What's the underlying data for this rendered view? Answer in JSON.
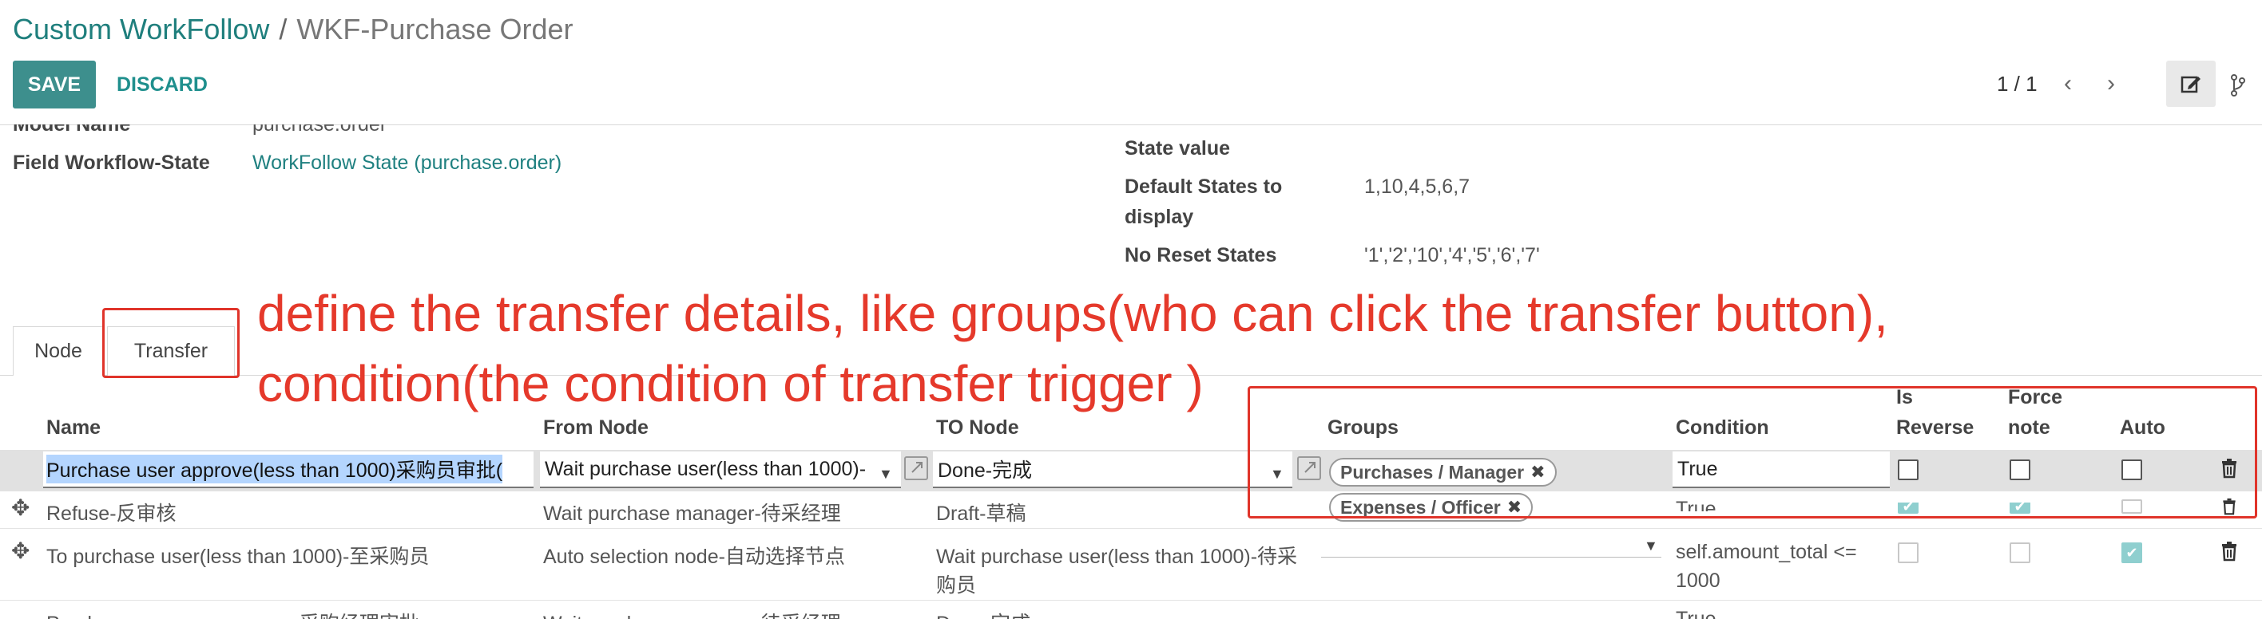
{
  "breadcrumb": {
    "parent": "Custom WorkFollow",
    "separator": "/",
    "current": "WKF-Purchase Order"
  },
  "toolbar": {
    "save": "SAVE",
    "discard": "DISCARD"
  },
  "pager": {
    "value": "1 / 1",
    "prev": "‹",
    "next": "›"
  },
  "form": {
    "model_name_label": "Model Name",
    "model_name_value": "purchase.order",
    "field_state_label": "Field Workflow-State",
    "field_state_value": "WorkFollow State (purchase.order)",
    "state_value_label": "State value",
    "default_states_label_1": "Default States to",
    "default_states_label_2": "display",
    "default_states_value": "1,10,4,5,6,7",
    "no_reset_label": "No Reset States",
    "no_reset_value": "'1','2','10','4','5','6','7'"
  },
  "tabs": [
    "Node",
    "Transfer"
  ],
  "annotation": {
    "line1": "define the transfer details, like groups(who can click the transfer button),",
    "line2": "condition(the condition of transfer trigger )"
  },
  "table": {
    "headers": {
      "name": "Name",
      "from": "From Node",
      "to": "TO Node",
      "groups": "Groups",
      "condition": "Condition",
      "is_reverse_1": "Is",
      "is_reverse_2": "Reverse",
      "force_note_1": "Force",
      "force_note_2": "note",
      "auto": "Auto"
    },
    "edit_row": {
      "name": "Purchase user approve(less than 1000)采购员审批(",
      "from": "Wait purchase user(less than 1000)-",
      "to": "Done-完成",
      "groups": [
        "Purchases / Manager",
        "Expenses / Officer"
      ],
      "condition": "True"
    },
    "rows": [
      {
        "name": "Refuse-反审核",
        "from": "Wait purchase manager-待采经理",
        "to": "Draft-草稿",
        "condition": "True"
      },
      {
        "name": "To purchase user(less than 1000)-至采购员",
        "from": "Auto selection node-自动选择节点",
        "to_1": "Wait purchase user(less than 1000)-待采",
        "to_2": "购员",
        "condition_1": "self.amount_total <=",
        "condition_2": "1000"
      },
      {
        "name": "Purchase manager approve-采购经理审批",
        "from": "Wait purchase manager-待采经理",
        "to": "Done-完成",
        "condition": "True"
      }
    ]
  },
  "colors": {
    "accent": "#00A09D",
    "annotation": "#e5392b",
    "selected_row": "#e1e1e1"
  }
}
